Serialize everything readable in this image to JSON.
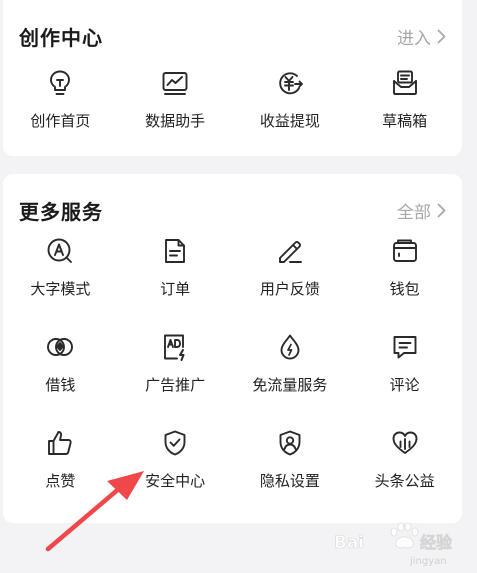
{
  "creation_center": {
    "title": "创作中心",
    "link_label": "进入",
    "items": [
      {
        "label": "创作首页",
        "icon": "lightbulb-icon"
      },
      {
        "label": "数据助手",
        "icon": "data-chart-icon"
      },
      {
        "label": "收益提现",
        "icon": "yuan-withdraw-icon"
      },
      {
        "label": "草稿箱",
        "icon": "draft-box-icon"
      }
    ]
  },
  "more_services": {
    "title": "更多服务",
    "link_label": "全部",
    "items": [
      {
        "label": "大字模式",
        "icon": "large-font-icon"
      },
      {
        "label": "订单",
        "icon": "order-document-icon"
      },
      {
        "label": "用户反馈",
        "icon": "feedback-pencil-icon"
      },
      {
        "label": "钱包",
        "icon": "wallet-icon"
      },
      {
        "label": "借钱",
        "icon": "borrow-money-icon"
      },
      {
        "label": "广告推广",
        "icon": "ad-promotion-icon"
      },
      {
        "label": "免流量服务",
        "icon": "data-free-icon"
      },
      {
        "label": "评论",
        "icon": "comment-icon"
      },
      {
        "label": "点赞",
        "icon": "thumbs-up-icon"
      },
      {
        "label": "安全中心",
        "icon": "security-shield-icon"
      },
      {
        "label": "隐私设置",
        "icon": "privacy-icon"
      },
      {
        "label": "头条公益",
        "icon": "charity-heart-icon"
      }
    ]
  },
  "colors": {
    "background": "#f3f3f5",
    "card": "#ffffff",
    "link_gray": "#a8a8a8",
    "annotation_arrow": "#f0474a"
  }
}
